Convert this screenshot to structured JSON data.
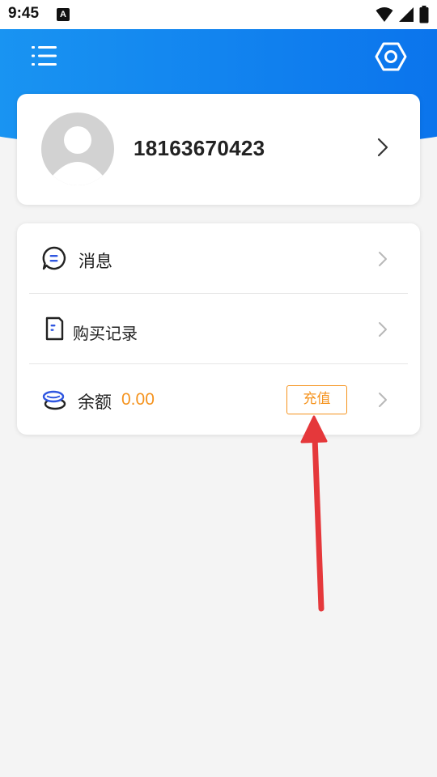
{
  "status_bar": {
    "time": "9:45",
    "notification_letter": "A"
  },
  "header": {
    "menu_icon": "list-menu-icon",
    "settings_icon": "hexagon-settings-icon"
  },
  "profile": {
    "phone": "18163670423",
    "avatar_icon": "default-avatar-icon"
  },
  "menu": {
    "messages": {
      "label": "消息",
      "icon": "message-icon"
    },
    "purchase_records": {
      "label": "购买记录",
      "icon": "document-icon"
    },
    "balance": {
      "label": "余额",
      "value": "0.00",
      "icon": "coins-icon",
      "recharge_label": "充值"
    }
  },
  "colors": {
    "header_blue": "#0a72ec",
    "accent_orange": "#f5931e",
    "annotation_red": "#e5383b"
  }
}
